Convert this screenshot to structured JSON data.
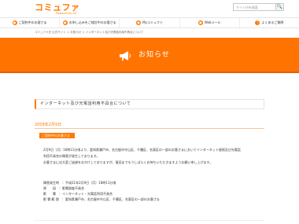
{
  "header": {
    "logo": "コミュファ",
    "logo_sub": "Powered by ctc",
    "search_placeholder": "サイト内を検索",
    "search_button": "🔍"
  },
  "nav": {
    "items": [
      {
        "label": "ご契約中のお客さま"
      },
      {
        "label": "お申し込みをご検討中のお客さま"
      },
      {
        "label": "Myコミュファ"
      },
      {
        "label": "Webメール"
      },
      {
        "label": "よくあるご質問"
      }
    ]
  },
  "breadcrumb": "コミュファ光 公式サイト ＞ お知らせ ＞ インターネット及び光電話利用不具合について",
  "hero": {
    "title": "お知らせ"
  },
  "article": {
    "title": "インターネット及び光電話利用不具合について",
    "date": "2009年2月9日",
    "category": "ご契約中のお客さま",
    "body": [
      "2月9日（月）16時11分頃より、愛知県瀬戸市、名古屋市守山区、千種区、名東区の一部のお客さまにおいてインターネット接続及び光電話",
      "利用不具合の障害が発生しております。",
      "お客さまには大変ご迷惑をおかけしておりますが、復旧までもうしばらくお待ちいただきますようお願い申し上げます。"
    ],
    "details": [
      "障害発生時　：平成21年2月9日（月）16時11分頃",
      "原　　因　：影響調査不具合",
      "影　　響　：インターネット・光電話利用不具合",
      "影 響 範 囲　：愛知県瀬戸市、名古屋市守山区、千種区、名東区の一部のお客さま"
    ]
  },
  "colors": {
    "accent": "#ff7a00",
    "hero": "#ff7400"
  }
}
